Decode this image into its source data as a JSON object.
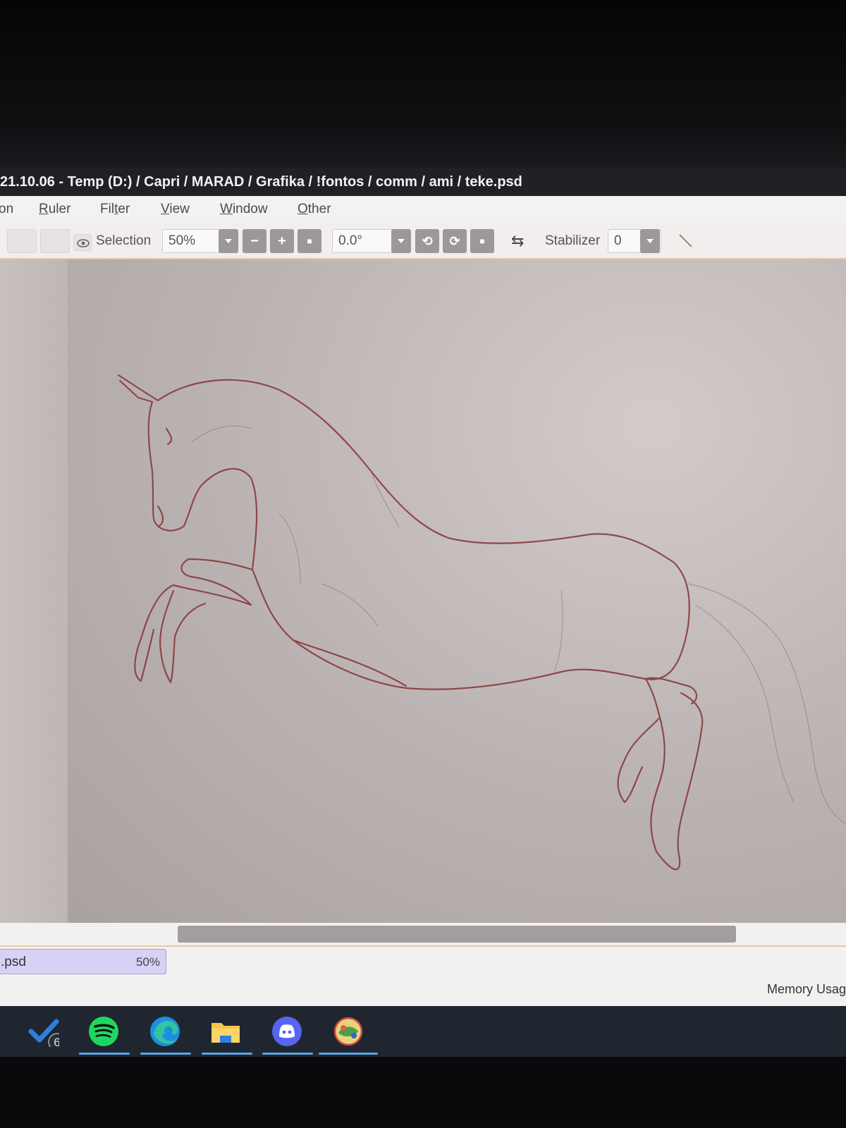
{
  "window": {
    "title": "21.10.06 - Temp (D:) / Capri / MARAD / Grafika / !fontos / comm / ami / teke.psd"
  },
  "menu": {
    "items": [
      {
        "label": "on"
      },
      {
        "label": "Ruler"
      },
      {
        "label": "Filter"
      },
      {
        "label": "View"
      },
      {
        "label": "Window"
      },
      {
        "label": "Other"
      }
    ]
  },
  "toolbar": {
    "selection_label": "Selection",
    "zoom_value": "50%",
    "zoom_out_label": "−",
    "zoom_in_label": "+",
    "zoom_reset_label": "■",
    "rotation_value": "0.0°",
    "rotate_left_label": "⟲",
    "rotate_right_label": "⟳",
    "rotate_reset_label": "■",
    "flip_label": "⇆",
    "stabilizer_label": "Stabilizer",
    "stabilizer_value": "0",
    "colors": {
      "button_gray": "#9b979a",
      "accent_line": "#e4c6a8"
    }
  },
  "canvas": {
    "subject": "horse-sketch",
    "stroke_color": "#8a3b3e",
    "background_color": "#c4bcbb"
  },
  "scrollbar": {
    "position_fraction": 0.21,
    "visible_fraction": 0.66
  },
  "status": {
    "file_name": ".psd",
    "file_zoom": "50%",
    "memory_label": "Memory Usag"
  },
  "taskbar": {
    "apps": [
      {
        "name": "todo",
        "icon": "checkmark-icon",
        "badge": "6"
      },
      {
        "name": "spotify",
        "icon": "spotify-icon"
      },
      {
        "name": "edge",
        "icon": "edge-icon"
      },
      {
        "name": "file-explorer",
        "icon": "folder-icon"
      },
      {
        "name": "discord",
        "icon": "discord-icon"
      },
      {
        "name": "paint-tool",
        "icon": "paint-app-icon",
        "active": true
      }
    ],
    "colors": {
      "spotify": "#1ed760",
      "discord": "#5865f2",
      "underline": "#5ba5e8"
    }
  }
}
